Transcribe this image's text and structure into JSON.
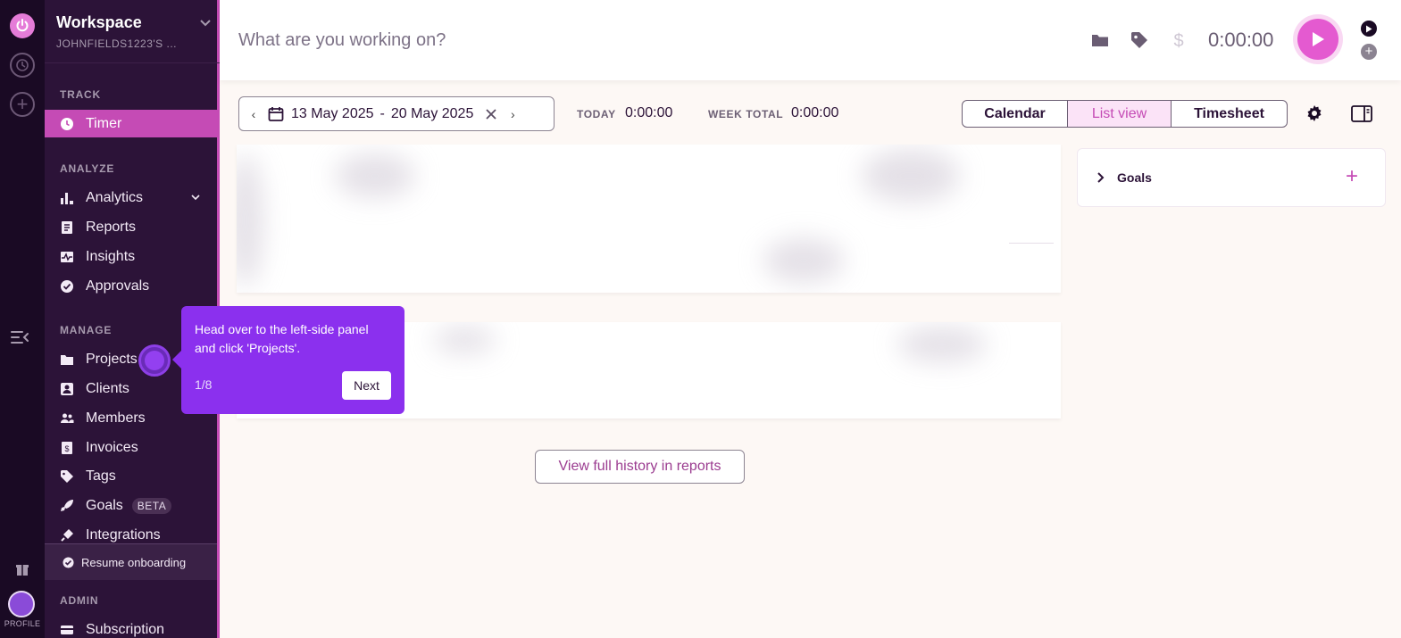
{
  "workspace": {
    "name": "Workspace",
    "owner": "JOHNFIELDS1223'S ..."
  },
  "sidebar": {
    "sections": {
      "track": "TRACK",
      "analyze": "ANALYZE",
      "manage": "MANAGE",
      "admin": "ADMIN"
    },
    "items": [
      {
        "label": "Timer",
        "icon": "clock-icon",
        "active": true
      },
      {
        "label": "Analytics",
        "icon": "bar-chart-icon"
      },
      {
        "label": "Reports",
        "icon": "document-icon"
      },
      {
        "label": "Insights",
        "icon": "activity-icon"
      },
      {
        "label": "Approvals",
        "icon": "check-circle-icon"
      },
      {
        "label": "Projects",
        "icon": "folder-icon"
      },
      {
        "label": "Clients",
        "icon": "contact-icon"
      },
      {
        "label": "Members",
        "icon": "people-icon"
      },
      {
        "label": "Invoices",
        "icon": "invoice-icon"
      },
      {
        "label": "Tags",
        "icon": "tag-icon"
      },
      {
        "label": "Goals",
        "icon": "rocket-icon",
        "badge": "BETA"
      },
      {
        "label": "Integrations",
        "icon": "plug-icon"
      },
      {
        "label": "Subscription",
        "icon": "card-icon"
      }
    ],
    "resume_onboarding": "Resume onboarding"
  },
  "rail": {
    "profile_label": "PROFILE"
  },
  "topbar": {
    "placeholder": "What are you working on?",
    "timer": "0:00:00"
  },
  "toolbar": {
    "date_start": "13 May 2025",
    "date_sep": "-",
    "date_end": "20 May 2025",
    "today_label": "TODAY",
    "today_value": "0:00:00",
    "week_label": "WEEK TOTAL",
    "week_value": "0:00:00",
    "views": [
      "Calendar",
      "List view",
      "Timesheet"
    ],
    "selected_view": "List view"
  },
  "goals_panel": {
    "title": "Goals"
  },
  "history_button": "View full history in reports",
  "onboarding": {
    "text": "Head over to the left-side panel and click 'Projects'.",
    "step": "1/8",
    "next": "Next"
  },
  "colors": {
    "accent": "#c54bb5",
    "sidebar_bg": "#2c1338",
    "rail_bg": "#1a0a24",
    "tooltip": "#8b30ee",
    "play": "#e45ad0"
  }
}
